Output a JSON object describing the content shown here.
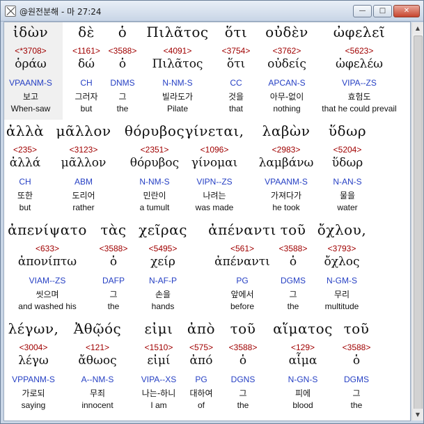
{
  "window": {
    "title": "@원전분해 - 마 27:24",
    "min_label": "—",
    "max_label": "□",
    "close_label": "✕"
  },
  "rows": [
    {
      "words": [
        {
          "greek": "ἰδὼν",
          "strong": "<*3708>",
          "lemma": "ὁράω",
          "parse": "VPAANM-S",
          "korean": "보고",
          "english": "When-saw"
        },
        {
          "greek": "δὲ",
          "strong": "<1161>",
          "lemma": "δώ",
          "parse": "CH",
          "korean": "그러자",
          "english": "but"
        },
        {
          "greek": "ὁ",
          "strong": "<3588>",
          "lemma": "ὁ",
          "parse": "DNMS",
          "korean": "그",
          "english": "the"
        },
        {
          "greek": "Πιλᾶτος",
          "strong": "<4091>",
          "lemma": "Πιλᾶτος",
          "parse": "N-NM-S",
          "korean": "빌라도가",
          "english": "Pilate"
        },
        {
          "greek": "ὅτι",
          "strong": "<3754>",
          "lemma": "ὅτι",
          "parse": "CC",
          "korean": "것을",
          "english": "that"
        },
        {
          "greek": "οὐδὲν",
          "strong": "<3762>",
          "lemma": "οὐδείς",
          "parse": "APCAN-S",
          "korean": "아무-없이",
          "english": "nothing"
        },
        {
          "greek": "ὠφελεῖ",
          "strong": "<5623>",
          "lemma": "ὠφελέω",
          "parse": "VIPA--ZS",
          "korean": "효험도",
          "english": "that he could prevail"
        }
      ]
    },
    {
      "words": [
        {
          "greek": "ἀλλὰ",
          "strong": "<235>",
          "lemma": "ἀλλά",
          "parse": "CH",
          "korean": "또한",
          "english": "but"
        },
        {
          "greek": "μᾶλλον",
          "strong": "<3123>",
          "lemma": "μᾶλλον",
          "parse": "ABM",
          "korean": "도리어",
          "english": "rather"
        },
        {
          "greek": "θόρυβος",
          "strong": "<2351>",
          "lemma": "θόρυβος",
          "parse": "N-NM-S",
          "korean": "민란이",
          "english": "a tumult"
        },
        {
          "greek": "γίνεται,",
          "strong": "<1096>",
          "lemma": "γίνομαι",
          "parse": "VIPN--ZS",
          "korean": "나려는",
          "english": "was made"
        },
        {
          "greek": "λαβὼν",
          "strong": "<2983>",
          "lemma": "λαμβάνω",
          "parse": "VPAANM-S",
          "korean": "가져다가",
          "english": "he took"
        },
        {
          "greek": "ὕδωρ",
          "strong": "<5204>",
          "lemma": "ὕδωρ",
          "parse": "N-AN-S",
          "korean": "물을",
          "english": "water"
        }
      ]
    },
    {
      "words": [
        {
          "greek": "ἀπενίψατο",
          "strong": "<633>",
          "lemma": "ἀπονίπτω",
          "parse": "VIAM--ZS",
          "korean": "씻으며",
          "english": "and washed his"
        },
        {
          "greek": "τὰς",
          "strong": "<3588>",
          "lemma": "ὁ",
          "parse": "DAFP",
          "korean": "그",
          "english": "the"
        },
        {
          "greek": "χεῖρας",
          "strong": "<5495>",
          "lemma": "χείρ",
          "parse": "N-AF-P",
          "korean": "손을",
          "english": "hands"
        },
        {
          "greek": "ἀπέναντι",
          "strong": "<561>",
          "lemma": "ἀπέναντι",
          "parse": "PG",
          "korean": "앞에서",
          "english": "before"
        },
        {
          "greek": "τοῦ",
          "strong": "<3588>",
          "lemma": "ὁ",
          "parse": "DGMS",
          "korean": "그",
          "english": "the"
        },
        {
          "greek": "ὄχλου,",
          "strong": "<3793>",
          "lemma": "ὄχλος",
          "parse": "N-GM-S",
          "korean": "무리",
          "english": "multitude"
        }
      ]
    },
    {
      "words": [
        {
          "greek": "λέγων,",
          "strong": "<3004>",
          "lemma": "λέγω",
          "parse": "VPPANM-S",
          "korean": "가로되",
          "english": "saying"
        },
        {
          "greek": "Ἀθῷός",
          "strong": "<121>",
          "lemma": "ἄθωος",
          "parse": "A--NM-S",
          "korean": "무죄",
          "english": "innocent"
        },
        {
          "greek": "εἰμι",
          "strong": "<1510>",
          "lemma": "εἰμί",
          "parse": "VIPA--XS",
          "korean": "나는-하니",
          "english": "I am"
        },
        {
          "greek": "ἀπὸ",
          "strong": "<575>",
          "lemma": "ἀπό",
          "parse": "PG",
          "korean": "대하여",
          "english": "of"
        },
        {
          "greek": "τοῦ",
          "strong": "<3588>",
          "lemma": "ὁ",
          "parse": "DGNS",
          "korean": "그",
          "english": "the"
        },
        {
          "greek": "αἵματος",
          "strong": "<129>",
          "lemma": "αἷμα",
          "parse": "N-GN-S",
          "korean": "피에",
          "english": "blood"
        },
        {
          "greek": "τοῦ",
          "strong": "<3588>",
          "lemma": "ὁ",
          "parse": "DGMS",
          "korean": "그",
          "english": "the"
        }
      ]
    }
  ]
}
